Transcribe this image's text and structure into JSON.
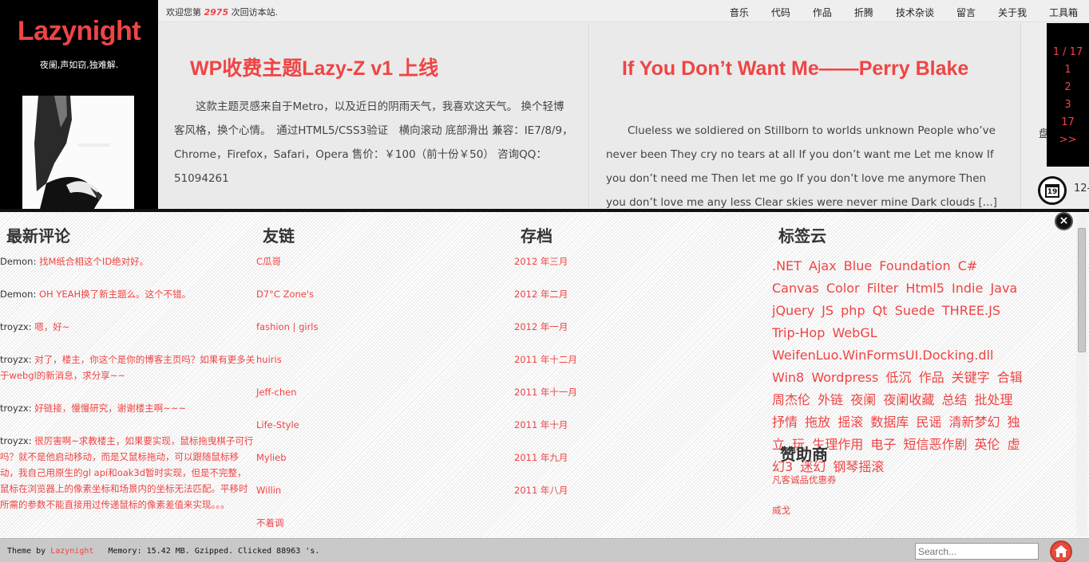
{
  "sidebar": {
    "site_title": "Lazynight",
    "tagline": "夜阑,声如窃,独难解."
  },
  "topbar": {
    "welcome_prefix": "欢迎您第",
    "visit_count": "2975",
    "welcome_suffix": "次回访本站.",
    "nav": [
      "音乐",
      "代码",
      "作品",
      "折腾",
      "技术杂谈",
      "留言",
      "关于我",
      "工具箱"
    ]
  },
  "posts": [
    {
      "title": "WP收费主题Lazy-Z v1 上线",
      "excerpt": "这款主题灵感来自于Metro，以及近日的阴雨天气，我喜欢这天气。 换个轻博客风格，换个心情。　通过HTML5/CSS3验证　横向滚动 底部滑出 兼容：IE7/8/9，Chrome，Firefox，Safari，Opera 售价：￥100（前十份￥50） 咨询QQ：51094261"
    },
    {
      "title": "If You Don’t Want Me——Perry Blake",
      "excerpt": "Clueless we soldiered on Stillborn to worlds unknown People who’ve never been They cry no tears at all If you don’t want me Let me know If you don’t need me Then let me go If you don’t love me anymore Then you don’t love me any less Clear skies were never mine Dark clouds [...]"
    }
  ],
  "pager": {
    "items": [
      "1 / 17",
      "1",
      "2",
      "3",
      "17",
      ">>"
    ]
  },
  "side_peek": {
    "text": "盘",
    "date": "12-"
  },
  "calendar_day": "19",
  "widgets": {
    "comments": {
      "title": "最新评论",
      "items": [
        {
          "author": "Demon:",
          "text": "找M纸合相这个ID绝对好。"
        },
        {
          "author": "Demon:",
          "text": "OH YEAH换了新主题么。这个不错。"
        },
        {
          "author": "troyzx:",
          "text": "嗯，好~"
        },
        {
          "author": "troyzx:",
          "text": "对了，楼主，你这个是你的博客主页吗？如果有更多关于webgl的新消息，求分享~~"
        },
        {
          "author": "troyzx:",
          "text": "好链接，慢慢研究，谢谢楼主啊~~~"
        },
        {
          "author": "troyzx:",
          "text": "很厉害啊~求教楼主，如果要实现，鼠标拖曳棋子可行吗？就不是他启动移动，而是又鼠标拖动，可以跟随鼠标移动，我自己用原生的gl api和oak3d暂时实现，但是不完整，鼠标在浏览器上的像素坐标和场景内的坐标无法匹配。平移时所需的参数不能直接用过传递鼠标的像素差值来实现。。。"
        }
      ]
    },
    "links": {
      "title": "友链",
      "items": [
        "C瓜哥",
        "D7°C Zone's",
        "fashion | girls",
        "huiris",
        "Jeff-chen",
        "Life-Style",
        "Mylieb",
        "Willin",
        "不着调"
      ]
    },
    "archives": {
      "title": "存档",
      "items": [
        "2012 年三月",
        "2012 年二月",
        "2012 年一月",
        "2011 年十二月",
        "2011 年十一月",
        "2011 年十月",
        "2011 年九月",
        "2011 年八月"
      ]
    },
    "tags": {
      "title": "标签云",
      "items": [
        ".NET",
        "Ajax",
        "Blue",
        "Foundation",
        "C#",
        "Canvas",
        "Color",
        "Filter",
        "Html5",
        "Indie",
        "Java",
        "jQuery",
        "JS",
        "php",
        "Qt",
        "Suede",
        "THREE.JS",
        "Trip-Hop",
        "WebGL",
        "WeifenLuo.WinFormsUI.Docking.dll",
        "Win8",
        "Wordpress",
        "低沉",
        "作品",
        "关键字",
        "合辑",
        "周杰伦",
        "外链",
        "夜阑",
        "夜阑收藏",
        "总结",
        "批处理",
        "抒情",
        "拖放",
        "摇滚",
        "数据库",
        "民谣",
        "清新梦幻",
        "独立",
        "玩",
        "生理作用",
        "电子",
        "短信恶作剧",
        "英伦",
        "虚幻3",
        "迷幻",
        "钢琴摇滚"
      ]
    },
    "sponsors": {
      "title": "赞助商",
      "items": [
        "凡客诚品优惠券",
        "威戈"
      ]
    }
  },
  "footer": {
    "theme_prefix": "Theme by",
    "theme_author": "Lazynight",
    "stats": "Memory: 15.42 MB. Gzipped. Clicked 88963 's.",
    "search_placeholder": "Search..."
  },
  "colors": {
    "accent": "#ef4444",
    "sidebar_bg": "#000000",
    "footer_bg": "#c9c9c9"
  }
}
